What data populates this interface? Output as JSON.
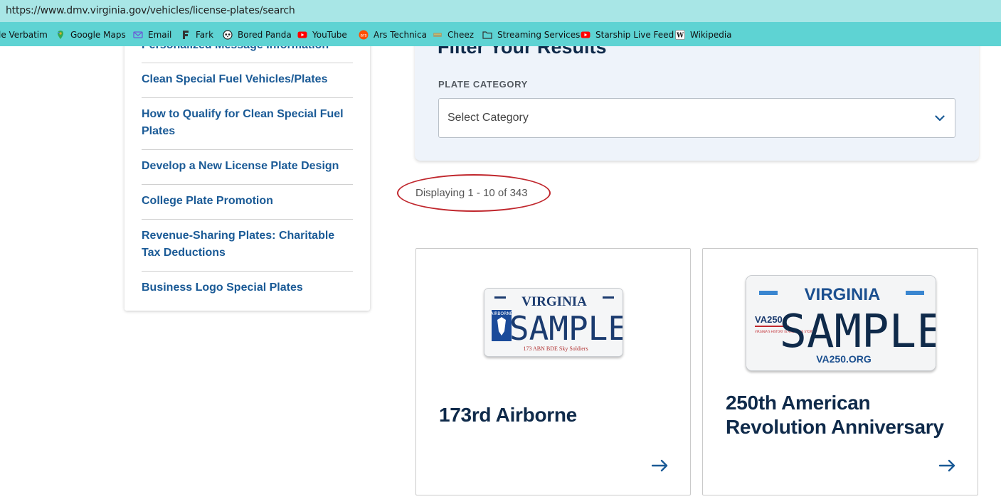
{
  "browser": {
    "url": "https://www.dmv.virginia.gov/vehicles/license-plates/search",
    "bookmarks": [
      {
        "label": "le Verbatim",
        "icon": "verbatim-icon",
        "color": ""
      },
      {
        "label": "Google Maps",
        "icon": "google-maps-icon",
        "color": "#34a853"
      },
      {
        "label": "Email",
        "icon": "email-icon",
        "color": "#6b5bd6"
      },
      {
        "label": "Fark",
        "icon": "fark-icon",
        "color": "#333333"
      },
      {
        "label": "Bored Panda",
        "icon": "bored-panda-icon",
        "color": "#222222"
      },
      {
        "label": "YouTube",
        "icon": "youtube-icon",
        "color": "#ff0000"
      },
      {
        "label": "Ars Technica",
        "icon": "ars-technica-icon",
        "color": "#ff4e00"
      },
      {
        "label": "Cheez",
        "icon": "cheez-icon",
        "color": "#7a8a6a"
      },
      {
        "label": "Streaming Services",
        "icon": "folder-icon",
        "color": "#333333"
      },
      {
        "label": "Starship Live Feed",
        "icon": "youtube-icon",
        "color": "#ff0000"
      },
      {
        "label": "Wikipedia",
        "icon": "wikipedia-icon",
        "color": "#ffffff"
      }
    ]
  },
  "sidebar": {
    "partial_top": "Personalized Message Information",
    "items": [
      {
        "label": "Clean Special Fuel Vehicles/Plates"
      },
      {
        "label": "How to Qualify for Clean Special Fuel Plates"
      },
      {
        "label": "Develop a New License Plate Design"
      },
      {
        "label": "College Plate Promotion"
      },
      {
        "label": "Revenue-Sharing Plates: Charitable Tax Deductions"
      },
      {
        "label": "Business Logo Special Plates"
      }
    ]
  },
  "filter": {
    "title": "Filter Your Results",
    "category_label": "PLATE CATEGORY",
    "select_placeholder": "Select Category"
  },
  "results": {
    "count_text": "Displaying 1 - 10 of 343",
    "highlight_color": "#c0272d"
  },
  "cards": [
    {
      "title": "173rd Airborne",
      "plate": {
        "state": "VIRGINIA",
        "text": "SAMPLE",
        "caption": "173 ABN BDE Sky Soldiers",
        "badge": "AIRBORNE"
      }
    },
    {
      "title": "250th American Revolution Anniversary",
      "plate": {
        "state": "VIRGINIA",
        "text": "SAMPLE",
        "caption": "VA250.ORG",
        "badge": "VA250",
        "tagline": "VIRGINIA'S HISTORY IS AMERICA'S STORY"
      }
    }
  ],
  "colors": {
    "link": "#1a5a96",
    "heading": "#0f2a4a",
    "filter_bg": "#eef3fa",
    "urlbar_bg": "#a8e6e6",
    "bookmarks_bg": "#5ed3d3",
    "plate_text": "#1b3b6f"
  }
}
